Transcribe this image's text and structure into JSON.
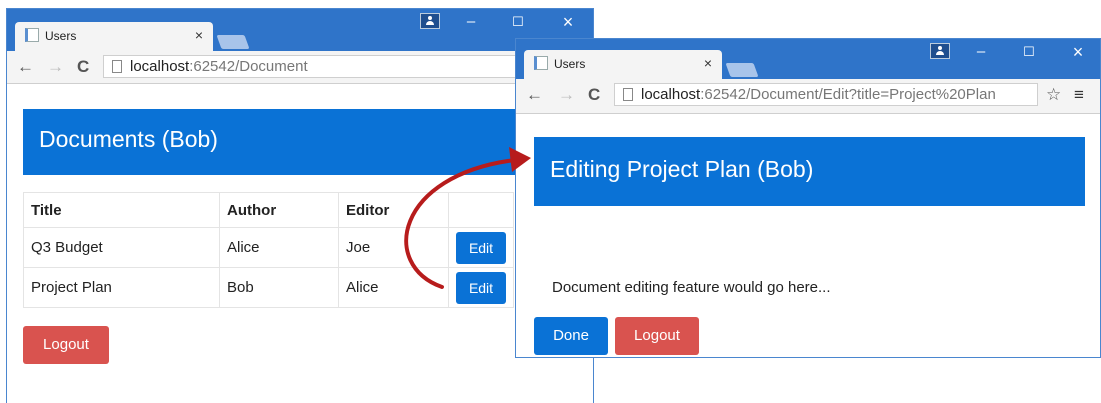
{
  "window1": {
    "tab_title": "Users",
    "url_host": "localhost",
    "url_rest": ":62542/Document",
    "header": "Documents (Bob)",
    "table": {
      "headers": [
        "Title",
        "Author",
        "Editor"
      ],
      "rows": [
        {
          "title": "Q3 Budget",
          "author": "Alice",
          "editor": "Joe",
          "action": "Edit"
        },
        {
          "title": "Project Plan",
          "author": "Bob",
          "editor": "Alice",
          "action": "Edit"
        }
      ]
    },
    "logout_label": "Logout"
  },
  "window2": {
    "tab_title": "Users",
    "url_host": "localhost",
    "url_rest": ":62542/Document/Edit?title=Project%20Plan",
    "header": "Editing Project Plan (Bob)",
    "message": "Document editing feature would go here...",
    "done_label": "Done",
    "logout_label": "Logout"
  },
  "glyphs": {
    "close": "×",
    "minimize": "–",
    "maximize": "☐",
    "back": "←",
    "forward": "→",
    "reload": "C",
    "star": "☆",
    "menu": "≡"
  },
  "colors": {
    "titlebar": "#2f74c9",
    "primary": "#0a72d6",
    "danger": "#d9534f",
    "arrow": "#b71c1c"
  }
}
